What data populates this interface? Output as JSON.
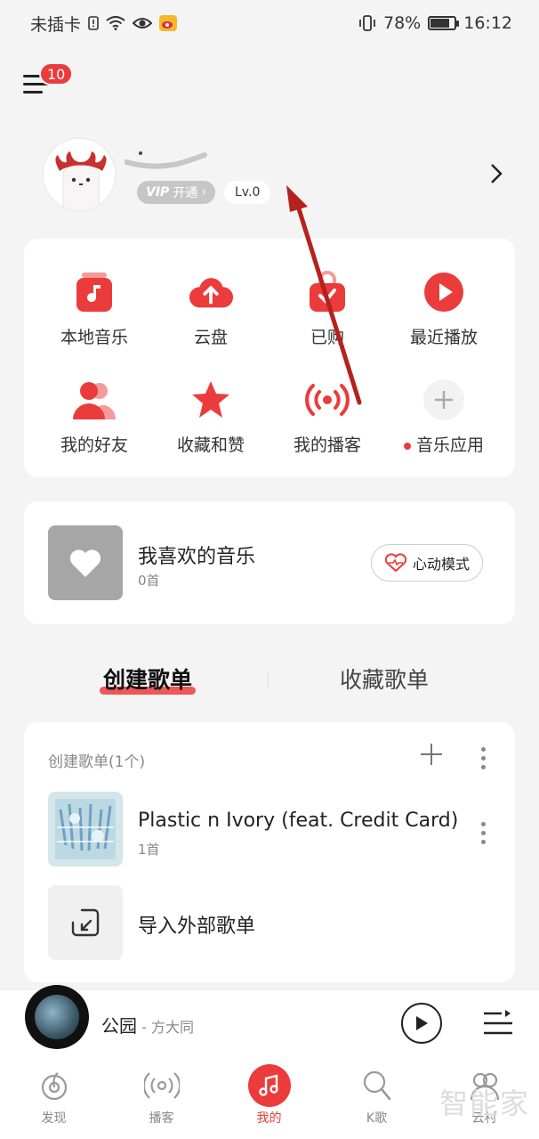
{
  "status_bar": {
    "carrier": "未插卡",
    "battery": "78%",
    "battery_level": 0.78,
    "time": "16:12"
  },
  "header": {
    "menu_badge": "10"
  },
  "profile": {
    "vip_label": "开通",
    "vip_tag": "VIP",
    "level": "Lv.0"
  },
  "shortcuts": [
    {
      "label": "本地音乐",
      "icon": "local-music-icon"
    },
    {
      "label": "云盘",
      "icon": "cloud-upload-icon"
    },
    {
      "label": "已购",
      "icon": "purchased-bag-icon"
    },
    {
      "label": "最近播放",
      "icon": "recent-play-icon"
    },
    {
      "label": "我的好友",
      "icon": "friends-icon"
    },
    {
      "label": "收藏和赞",
      "icon": "star-icon"
    },
    {
      "label": "我的播客",
      "icon": "podcast-icon"
    },
    {
      "label": "音乐应用",
      "icon": "add-app-icon"
    }
  ],
  "favorites": {
    "title": "我喜欢的音乐",
    "count": "0首",
    "heart_mode_label": "心动模式"
  },
  "tabs": {
    "created": "创建歌单",
    "collected": "收藏歌单"
  },
  "playlists": {
    "header": "创建歌单(1个)",
    "items": [
      {
        "title": "Plastic n Ivory (feat. Credit Card)",
        "count": "1首"
      }
    ],
    "import_label": "导入外部歌单"
  },
  "player": {
    "song": "公园",
    "artist": " - 方大同"
  },
  "bottom_nav": [
    {
      "label": "发现"
    },
    {
      "label": "播客"
    },
    {
      "label": "我的"
    },
    {
      "label": "K歌"
    },
    {
      "label": "云村"
    }
  ],
  "watermark": "智能家",
  "colors": {
    "accent": "#ec3b3b",
    "background": "#f4f4f4"
  }
}
